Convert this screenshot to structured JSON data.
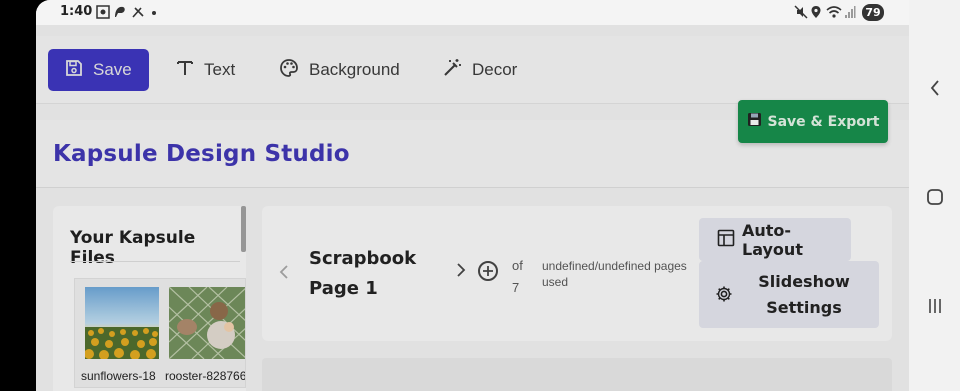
{
  "status_bar": {
    "time": "1:40",
    "battery": "79"
  },
  "toolbar": {
    "save_label": "Save",
    "text_label": "Text",
    "background_label": "Background",
    "decor_label": "Decor"
  },
  "header": {
    "title": "Kapsule Design Studio",
    "export_label": "Save & Export"
  },
  "files": {
    "title": "Your Kapsule Files",
    "items": [
      {
        "label": "sunflowers-18"
      },
      {
        "label": "rooster-828766"
      }
    ]
  },
  "page_nav": {
    "page_name": "Scrapbook Page 1",
    "of_text": "of 7",
    "pages_used": "undefined/undefined pages used"
  },
  "actions": {
    "autolayout_label": "Auto-Layout",
    "slideshow_label": "Slideshow Settings"
  },
  "colors": {
    "save_button": "#3c35b8",
    "export_button": "#17894a",
    "title": "#3e35ad"
  }
}
